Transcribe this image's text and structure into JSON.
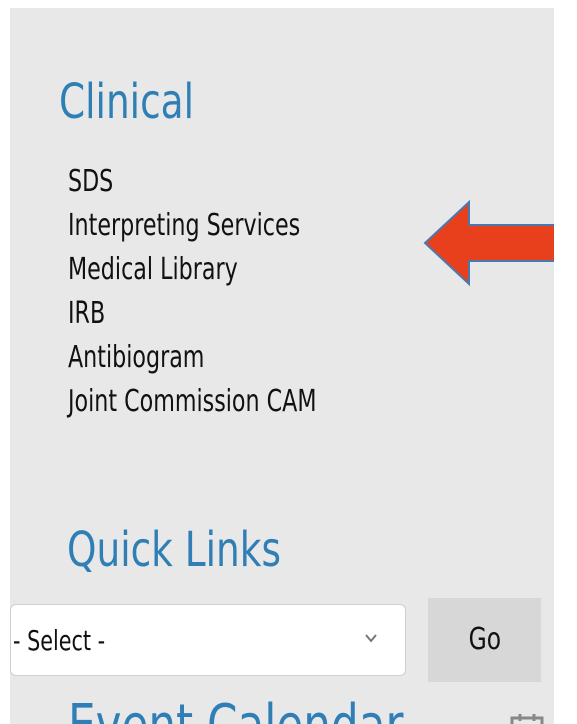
{
  "clinical": {
    "title": "Clinical",
    "links": [
      {
        "label": "SDS"
      },
      {
        "label": "Interpreting Services"
      },
      {
        "label": "Medical Library"
      },
      {
        "label": "IRB"
      },
      {
        "label": "Antibiogram"
      },
      {
        "label": "Joint Commission CAM"
      }
    ]
  },
  "quick_links": {
    "title": "Quick Links",
    "select_value": "- Select -",
    "go_label": "Go"
  },
  "next_section": {
    "title_partial": "Event Calendar"
  },
  "colors": {
    "heading": "#2f7fb6",
    "panel_bg": "#e8e8e8",
    "arrow_fill": "#e8401c",
    "arrow_outline": "#4a79b0",
    "go_button_bg": "#d7d7d7"
  },
  "icons": {
    "annotation": "arrow-left-icon",
    "dropdown": "chevron-down-icon",
    "calendar": "calendar-icon"
  }
}
